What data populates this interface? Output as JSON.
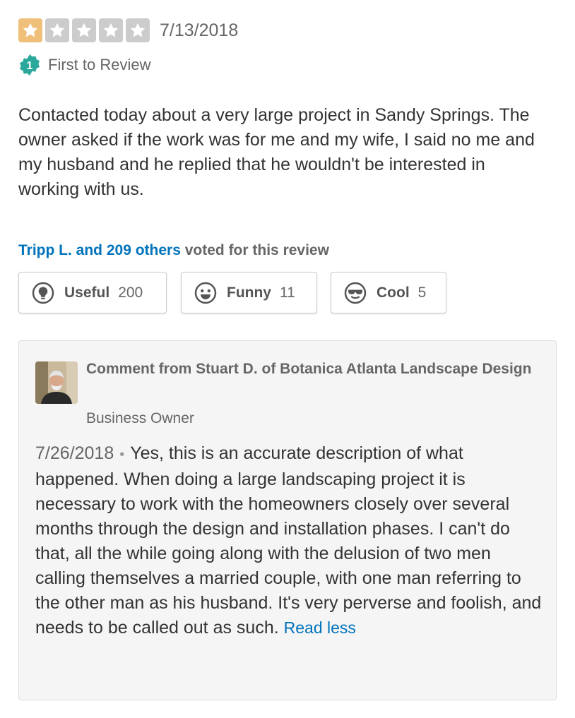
{
  "review": {
    "rating": 1,
    "max_rating": 5,
    "date": "7/13/2018",
    "badge_number": "1",
    "badge_label": "First to Review",
    "text": "Contacted today about a very large project in Sandy Springs. The owner asked if the work was for me and my wife, I said no me and my husband and he replied that he wouldn't be interested in working with us."
  },
  "votes": {
    "voters_link": "Tripp L. and 209 others",
    "voters_suffix": " voted for this review",
    "buttons": [
      {
        "label": "Useful",
        "count": "200",
        "icon": "lightbulb-icon"
      },
      {
        "label": "Funny",
        "count": "11",
        "icon": "smile-icon"
      },
      {
        "label": "Cool",
        "count": "5",
        "icon": "sunglasses-icon"
      }
    ]
  },
  "comment": {
    "heading": "Comment from Stuart D. of Botanica Atlanta Landscape Design",
    "role": "Business Owner",
    "date": "7/26/2018",
    "separator": "•",
    "text": "Yes, this is an accurate description of what happened. When doing a large landscaping project it is necessary to work with the homeowners closely over several months through the design and installation phases. I can't do that, all the while going along with the delusion of two men calling themselves a married couple, with one man referring to the other man as his husband. It's very perverse and foolish, and needs to be called out as such.",
    "read_less": "Read less"
  },
  "colors": {
    "star_filled": "#f0c07a",
    "star_empty": "#cccccc",
    "badge_teal": "#2ba89c",
    "link_blue": "#0073bb"
  }
}
